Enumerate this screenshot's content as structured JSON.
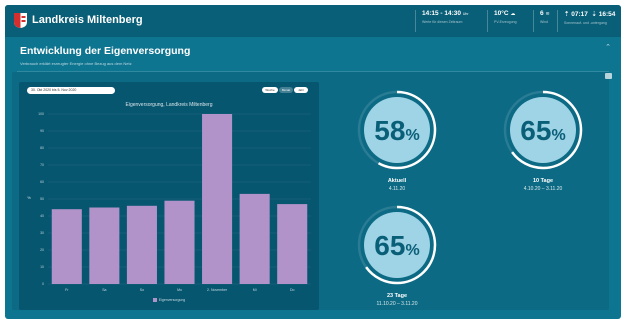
{
  "app": {
    "title": "Landkreis Miltenberg"
  },
  "header": {
    "time": {
      "value": "14:15 - 14:30",
      "unit": "Uhr",
      "caption": "Werte für diesen Zeitraum"
    },
    "temp": {
      "value": "10°C",
      "caption": "PV-Erzeugung"
    },
    "wind": {
      "value": "6",
      "caption": "Wind"
    },
    "sun": {
      "rise": "07:17",
      "set": "16:54",
      "caption": "Sonnenauf- und -untergang"
    }
  },
  "page": {
    "title": "Entwicklung der Eigenversorgung",
    "subtitle": "Verbrauch erklärt erzeugter Energie ohne Bezug aus dem Netz"
  },
  "chart_card": {
    "date_range": "30. Okt 2020 bis 5. Nov 2020",
    "toggle_options": [
      "Woche",
      "Monat",
      "Jahr"
    ]
  },
  "chart_data": {
    "type": "bar",
    "title": "Eigenversorgung, Landkreis Miltenberg",
    "ylabel": "%",
    "xlabel": "",
    "categories": [
      "Fr",
      "Sa",
      "So",
      "Mo",
      "2. November",
      "Mi",
      "Do"
    ],
    "values": [
      44,
      45,
      46,
      49,
      100,
      53,
      47
    ],
    "ylim": [
      0,
      100
    ],
    "yticks": [
      0,
      10,
      20,
      30,
      40,
      50,
      60,
      70,
      80,
      90,
      100
    ],
    "legend": "Eigenversorgung",
    "grid": true,
    "bar_color": "#b293c9"
  },
  "gauges": [
    {
      "value": "58",
      "unit": "%",
      "fraction": 0.58,
      "label": "Aktuell",
      "range": "4.11.20"
    },
    {
      "value": "65",
      "unit": "%",
      "fraction": 0.65,
      "label": "10 Tage",
      "range": "4.10.20 – 3.11.20"
    },
    {
      "value": "65",
      "unit": "%",
      "fraction": 0.65,
      "label": "23 Tage",
      "range": "11.10.20 – 3.11.20"
    }
  ],
  "colors": {
    "background": "#0e7591",
    "header": "#0a5f78",
    "chart_bg": "#075670",
    "gauge_fill": "#9fd3e6",
    "gauge_ring": "#ffffff"
  }
}
